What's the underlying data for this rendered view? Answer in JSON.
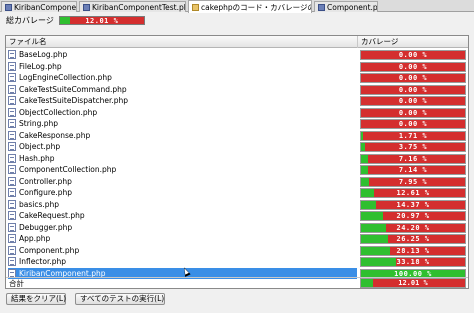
{
  "tabs": [
    {
      "label": "KiribanComponent.php",
      "icon": "php-file-icon"
    },
    {
      "label": "KiribanComponentTest.php",
      "icon": "php-file-icon"
    },
    {
      "label": "cakephpのコード・カバレージのレポート",
      "icon": "report-icon"
    },
    {
      "label": "Component.php",
      "icon": "php-file-icon"
    }
  ],
  "summary": {
    "label": "総カバレージ",
    "percent_text": "12.01 %",
    "fraction": 0.1201
  },
  "table": {
    "headers": {
      "file": "ファイル名",
      "coverage": "カバレージ"
    },
    "rows": [
      {
        "file": "BaseLog.php",
        "percent_text": "0.00 %",
        "fraction": 0.0
      },
      {
        "file": "FileLog.php",
        "percent_text": "0.00 %",
        "fraction": 0.0
      },
      {
        "file": "LogEngineCollection.php",
        "percent_text": "0.00 %",
        "fraction": 0.0
      },
      {
        "file": "CakeTestSuiteCommand.php",
        "percent_text": "0.00 %",
        "fraction": 0.0
      },
      {
        "file": "CakeTestSuiteDispatcher.php",
        "percent_text": "0.00 %",
        "fraction": 0.0
      },
      {
        "file": "ObjectCollection.php",
        "percent_text": "0.00 %",
        "fraction": 0.0
      },
      {
        "file": "String.php",
        "percent_text": "0.00 %",
        "fraction": 0.0
      },
      {
        "file": "CakeResponse.php",
        "percent_text": "1.71 %",
        "fraction": 0.0171
      },
      {
        "file": "Object.php",
        "percent_text": "3.75 %",
        "fraction": 0.0375
      },
      {
        "file": "Hash.php",
        "percent_text": "7.16 %",
        "fraction": 0.0716
      },
      {
        "file": "ComponentCollection.php",
        "percent_text": "7.14 %",
        "fraction": 0.0714
      },
      {
        "file": "Controller.php",
        "percent_text": "7.95 %",
        "fraction": 0.0795
      },
      {
        "file": "Configure.php",
        "percent_text": "12.61 %",
        "fraction": 0.1261
      },
      {
        "file": "basics.php",
        "percent_text": "14.37 %",
        "fraction": 0.1437
      },
      {
        "file": "CakeRequest.php",
        "percent_text": "20.97 %",
        "fraction": 0.2097
      },
      {
        "file": "Debugger.php",
        "percent_text": "24.20 %",
        "fraction": 0.242
      },
      {
        "file": "App.php",
        "percent_text": "26.25 %",
        "fraction": 0.2625
      },
      {
        "file": "Component.php",
        "percent_text": "28.13 %",
        "fraction": 0.2813
      },
      {
        "file": "Inflector.php",
        "percent_text": "33.18 %",
        "fraction": 0.3318
      },
      {
        "file": "KiribanComponent.php",
        "percent_text": "100.00 %",
        "fraction": 1.0,
        "selected": true
      }
    ],
    "total": {
      "label": "合計",
      "percent_text": "12.01 %",
      "fraction": 0.1201
    }
  },
  "buttons": {
    "clear": "結果をクリア(L)",
    "run_all": "すべてのテストの実行(L)"
  },
  "colors": {
    "covered": "#2fbf2f",
    "uncovered": "#d42e2e",
    "selected_row": "#3a8ee6"
  }
}
